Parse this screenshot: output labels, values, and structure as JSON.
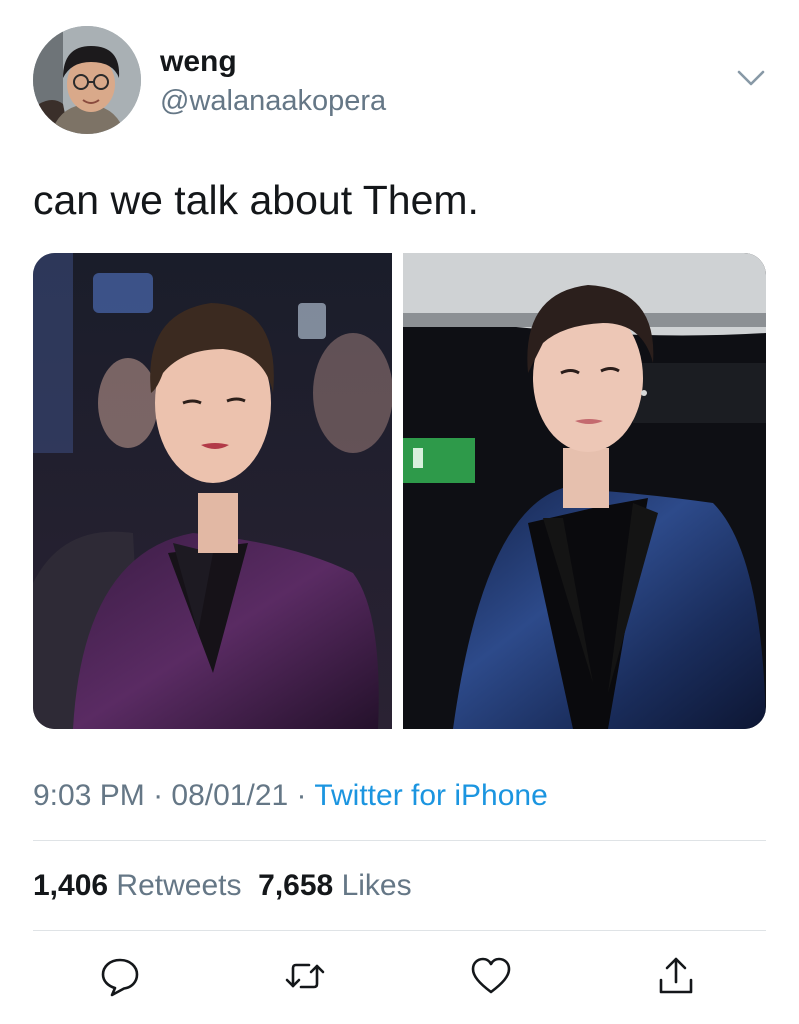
{
  "tweet": {
    "author": {
      "display_name": "weng",
      "handle": "@walanaakopera"
    },
    "text": "can we talk about Them.",
    "time": "9:03 PM",
    "date": "08/01/21",
    "source": "Twitter for iPhone",
    "separator": "·"
  },
  "stats": {
    "retweets_count": "1,406",
    "retweets_label": "Retweets",
    "likes_count": "7,658",
    "likes_label": "Likes"
  },
  "icons": {
    "menu": "chevron-down-icon",
    "reply": "reply-icon",
    "retweet": "retweet-icon",
    "like": "heart-icon",
    "share": "share-icon"
  },
  "colors": {
    "text": "#14171a",
    "secondary": "#657786",
    "link": "#1b95e0",
    "divider": "#dfe3e6"
  }
}
